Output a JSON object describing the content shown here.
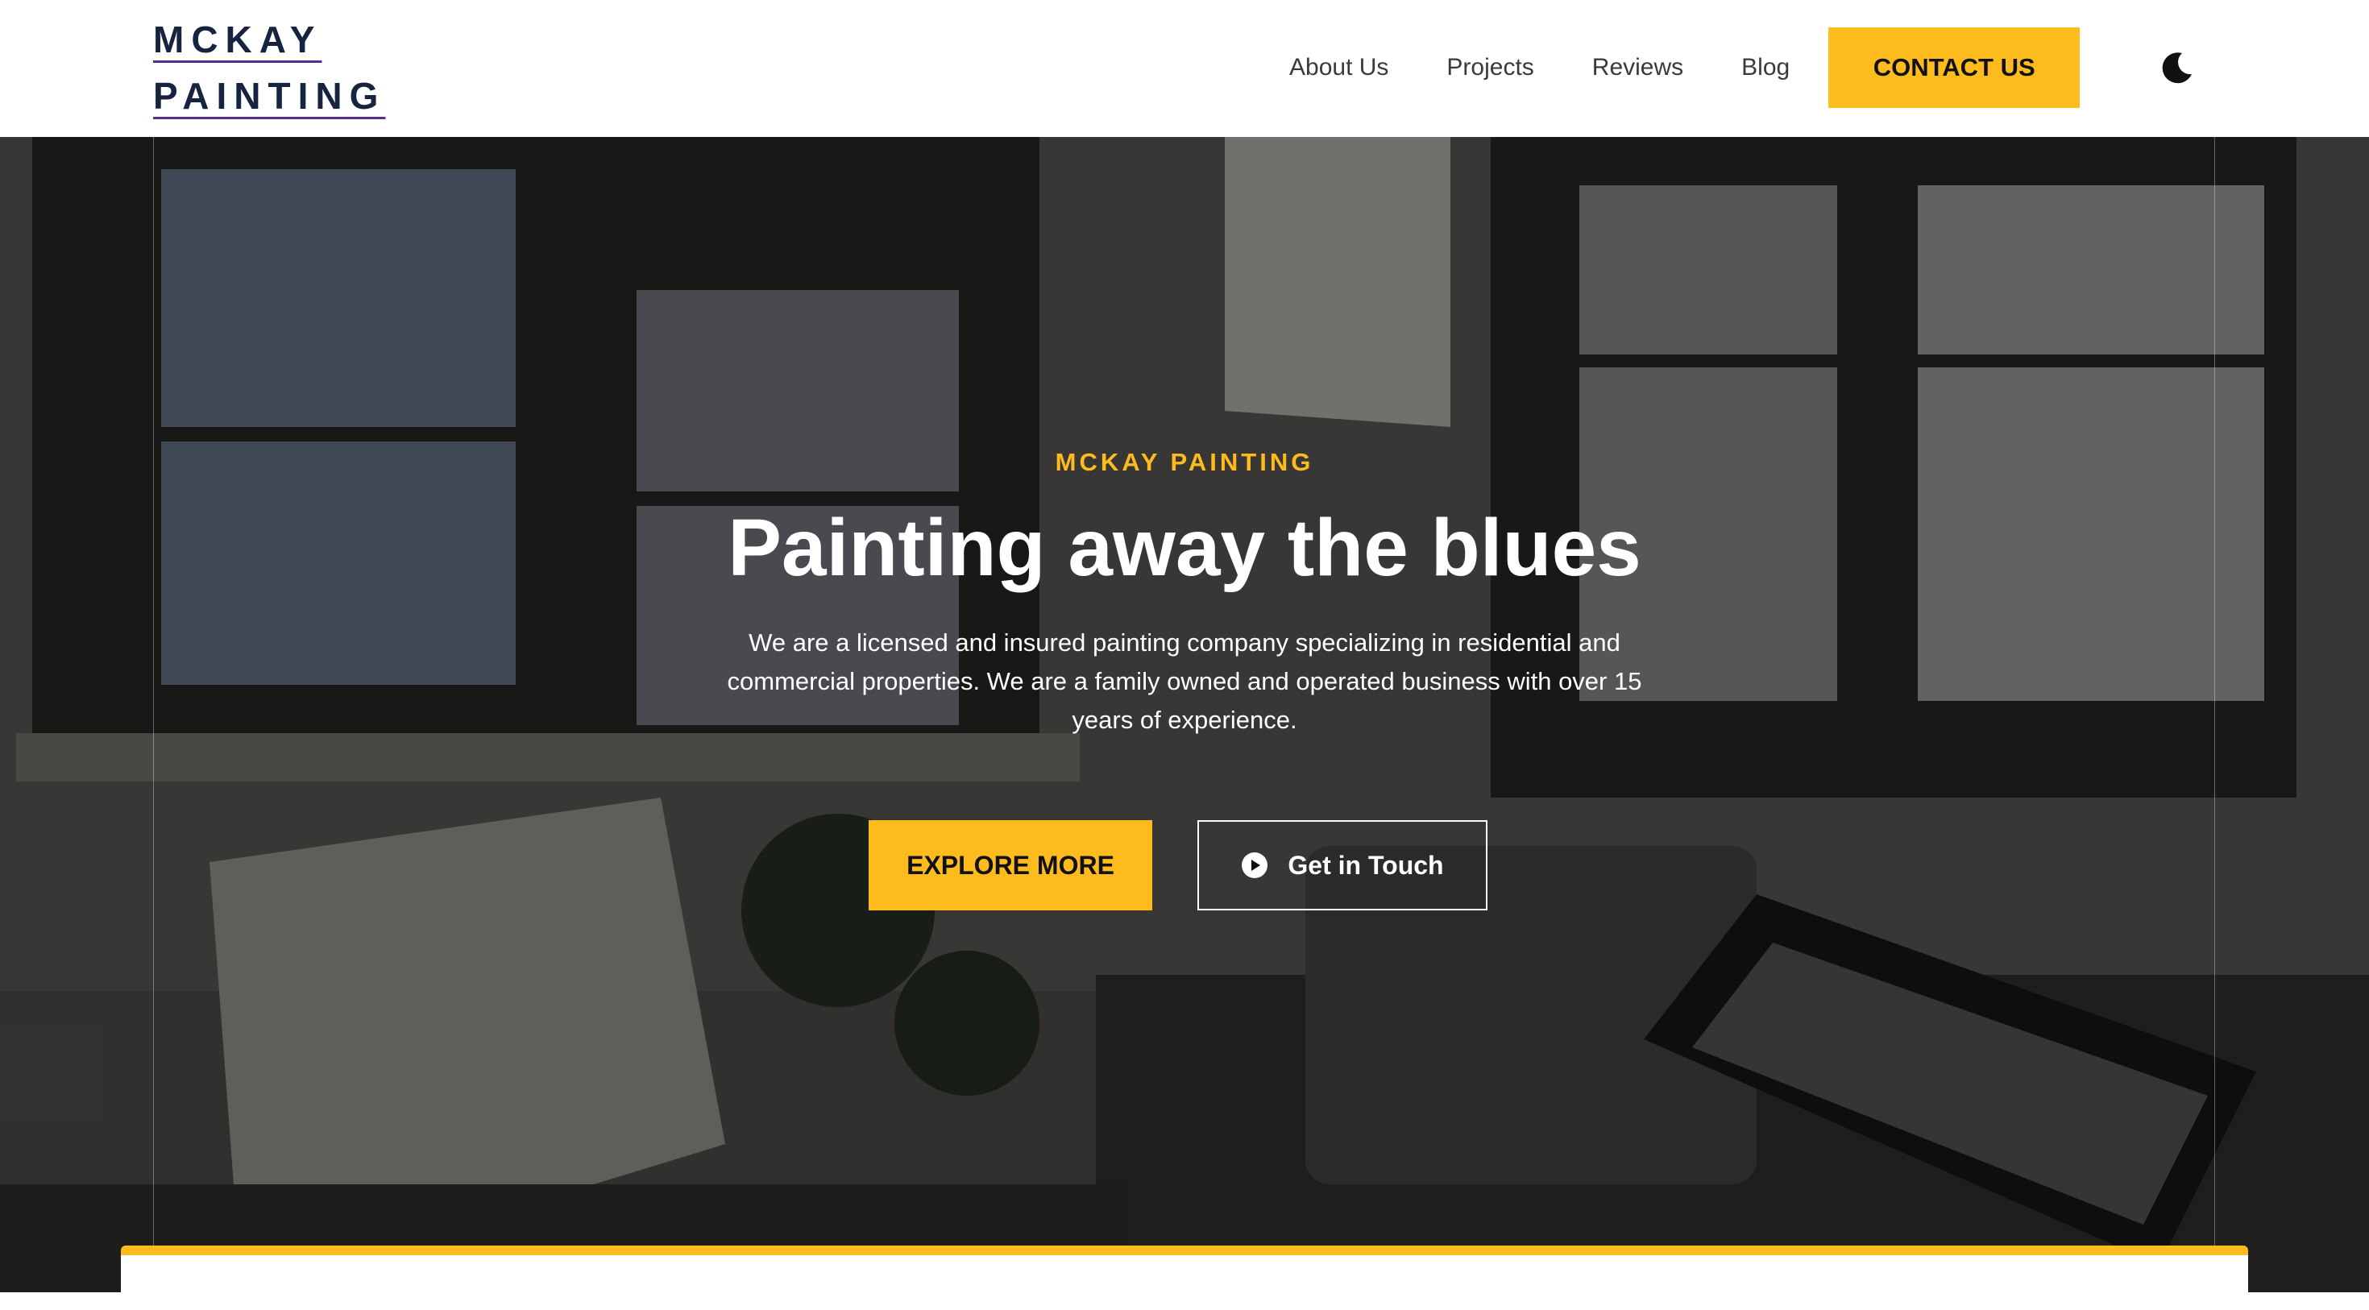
{
  "brand": {
    "line1": "MCKAY",
    "line2": "PAINTING"
  },
  "nav": {
    "items": [
      {
        "label": "About Us"
      },
      {
        "label": "Projects"
      },
      {
        "label": "Reviews"
      },
      {
        "label": "Blog"
      }
    ],
    "contact_label": "CONTACT US",
    "theme_toggle_icon": "moon-icon"
  },
  "hero": {
    "eyebrow": "MCKAY PAINTING",
    "title": "Painting away the blues",
    "description": "We are a licensed and insured painting company specializing in residential and commercial properties. We are a family owned and operated business with over 15 years of experience.",
    "primary_button": "EXPLORE MORE",
    "secondary_button": "Get in Touch",
    "secondary_icon": "play-circle-icon"
  },
  "colors": {
    "accent": "#fdbb1e",
    "logo_text": "#16243f",
    "logo_underline": "#5b2b8f"
  }
}
